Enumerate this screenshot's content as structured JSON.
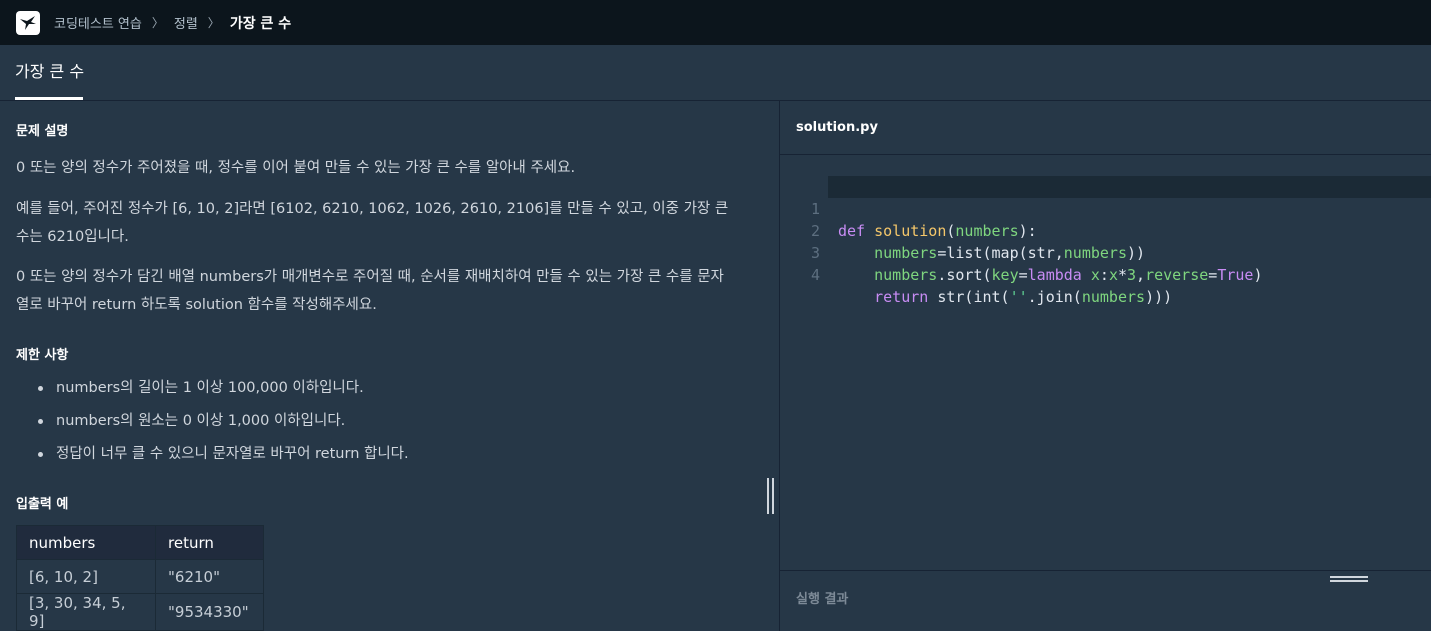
{
  "breadcrumb": {
    "items": [
      "코딩테스트 연습",
      "정렬"
    ],
    "current": "가장 큰 수"
  },
  "tab": {
    "label": "가장 큰 수"
  },
  "problem": {
    "description_title": "문제 설명",
    "paragraphs": [
      "0 또는 양의 정수가 주어졌을 때, 정수를 이어 붙여 만들 수 있는 가장 큰 수를 알아내 주세요.",
      "예를 들어, 주어진 정수가 [6, 10, 2]라면 [6102, 6210, 1062, 1026, 2610, 2106]를 만들 수 있고, 이중 가장 큰 수는 6210입니다.",
      "0 또는 양의 정수가 담긴 배열 numbers가 매개변수로 주어질 때, 순서를 재배치하여 만들 수 있는 가장 큰 수를 문자열로 바꾸어 return 하도록 solution 함수를 작성해주세요."
    ],
    "constraints_title": "제한 사항",
    "constraints": [
      "numbers의 길이는 1 이상 100,000 이하입니다.",
      "numbers의 원소는 0 이상 1,000 이하입니다.",
      "정답이 너무 클 수 있으니 문자열로 바꾸어 return 합니다."
    ],
    "examples_title": "입출력 예",
    "examples_table": {
      "headers": [
        "numbers",
        "return"
      ],
      "rows": [
        [
          "[6, 10, 2]",
          "\"6210\""
        ],
        [
          "[3, 30, 34, 5, 9]",
          "\"9534330\""
        ]
      ]
    }
  },
  "editor": {
    "filename": "solution.py",
    "line_numbers": [
      "1",
      "2",
      "3",
      "4"
    ]
  },
  "result": {
    "label": "실행 결과"
  },
  "icons": {
    "logo": "programmers-logo-icon",
    "splitter": "vertical-resize-handle-icon",
    "result_grip": "horizontal-resize-handle-icon"
  }
}
